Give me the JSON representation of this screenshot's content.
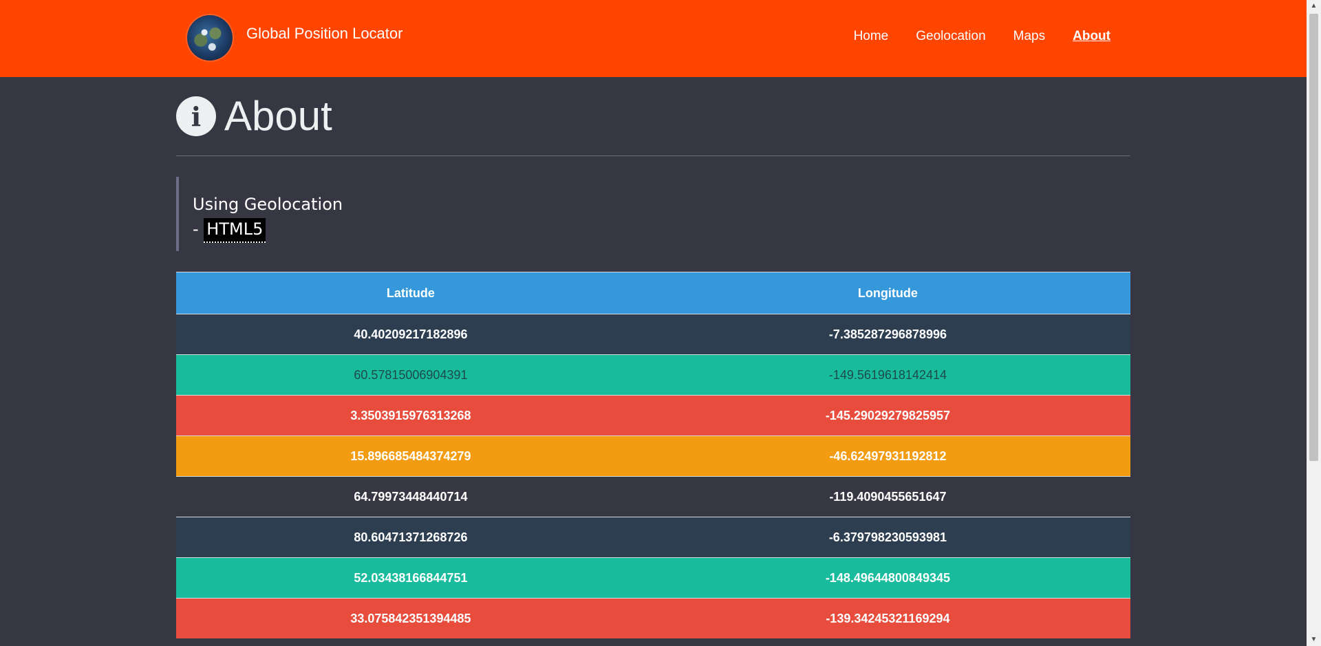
{
  "brand": {
    "title": "Global Position Locator",
    "logo_icon": "globe-icon"
  },
  "nav": {
    "items": [
      {
        "label": "Home"
      },
      {
        "label": "Geolocation"
      },
      {
        "label": "Maps"
      },
      {
        "label": "About"
      }
    ],
    "active": "About"
  },
  "page": {
    "title": "About",
    "icon": "info-icon",
    "icon_glyph": "i"
  },
  "quote": {
    "line1": "Using Geolocation",
    "prefix": "- ",
    "abbr": "HTML5"
  },
  "table": {
    "headers": [
      "Latitude",
      "Longitude"
    ],
    "rows": [
      {
        "lat": "40.40209217182896",
        "lng": "-7.385287296878996"
      },
      {
        "lat": "60.57815006904391",
        "lng": "-149.5619618142414"
      },
      {
        "lat": "3.3503915976313268",
        "lng": "-145.29029279825957"
      },
      {
        "lat": "15.896685484374279",
        "lng": "-46.62497931192812"
      },
      {
        "lat": "64.79973448440714",
        "lng": "-119.4090455651647"
      },
      {
        "lat": "80.60471371268726",
        "lng": "-6.379798230593981"
      },
      {
        "lat": "52.03438166844751",
        "lng": "-148.49644800849345"
      },
      {
        "lat": "33.075842351394485",
        "lng": "-139.34245321169294"
      }
    ]
  },
  "colors": {
    "navbar": "#ff4500",
    "background": "#373743",
    "header_row": "#3498db",
    "dark_row": "#2c3e50",
    "teal_row": "#18bc9c",
    "red_row": "#e74c3c",
    "orange_row": "#f39c12"
  }
}
